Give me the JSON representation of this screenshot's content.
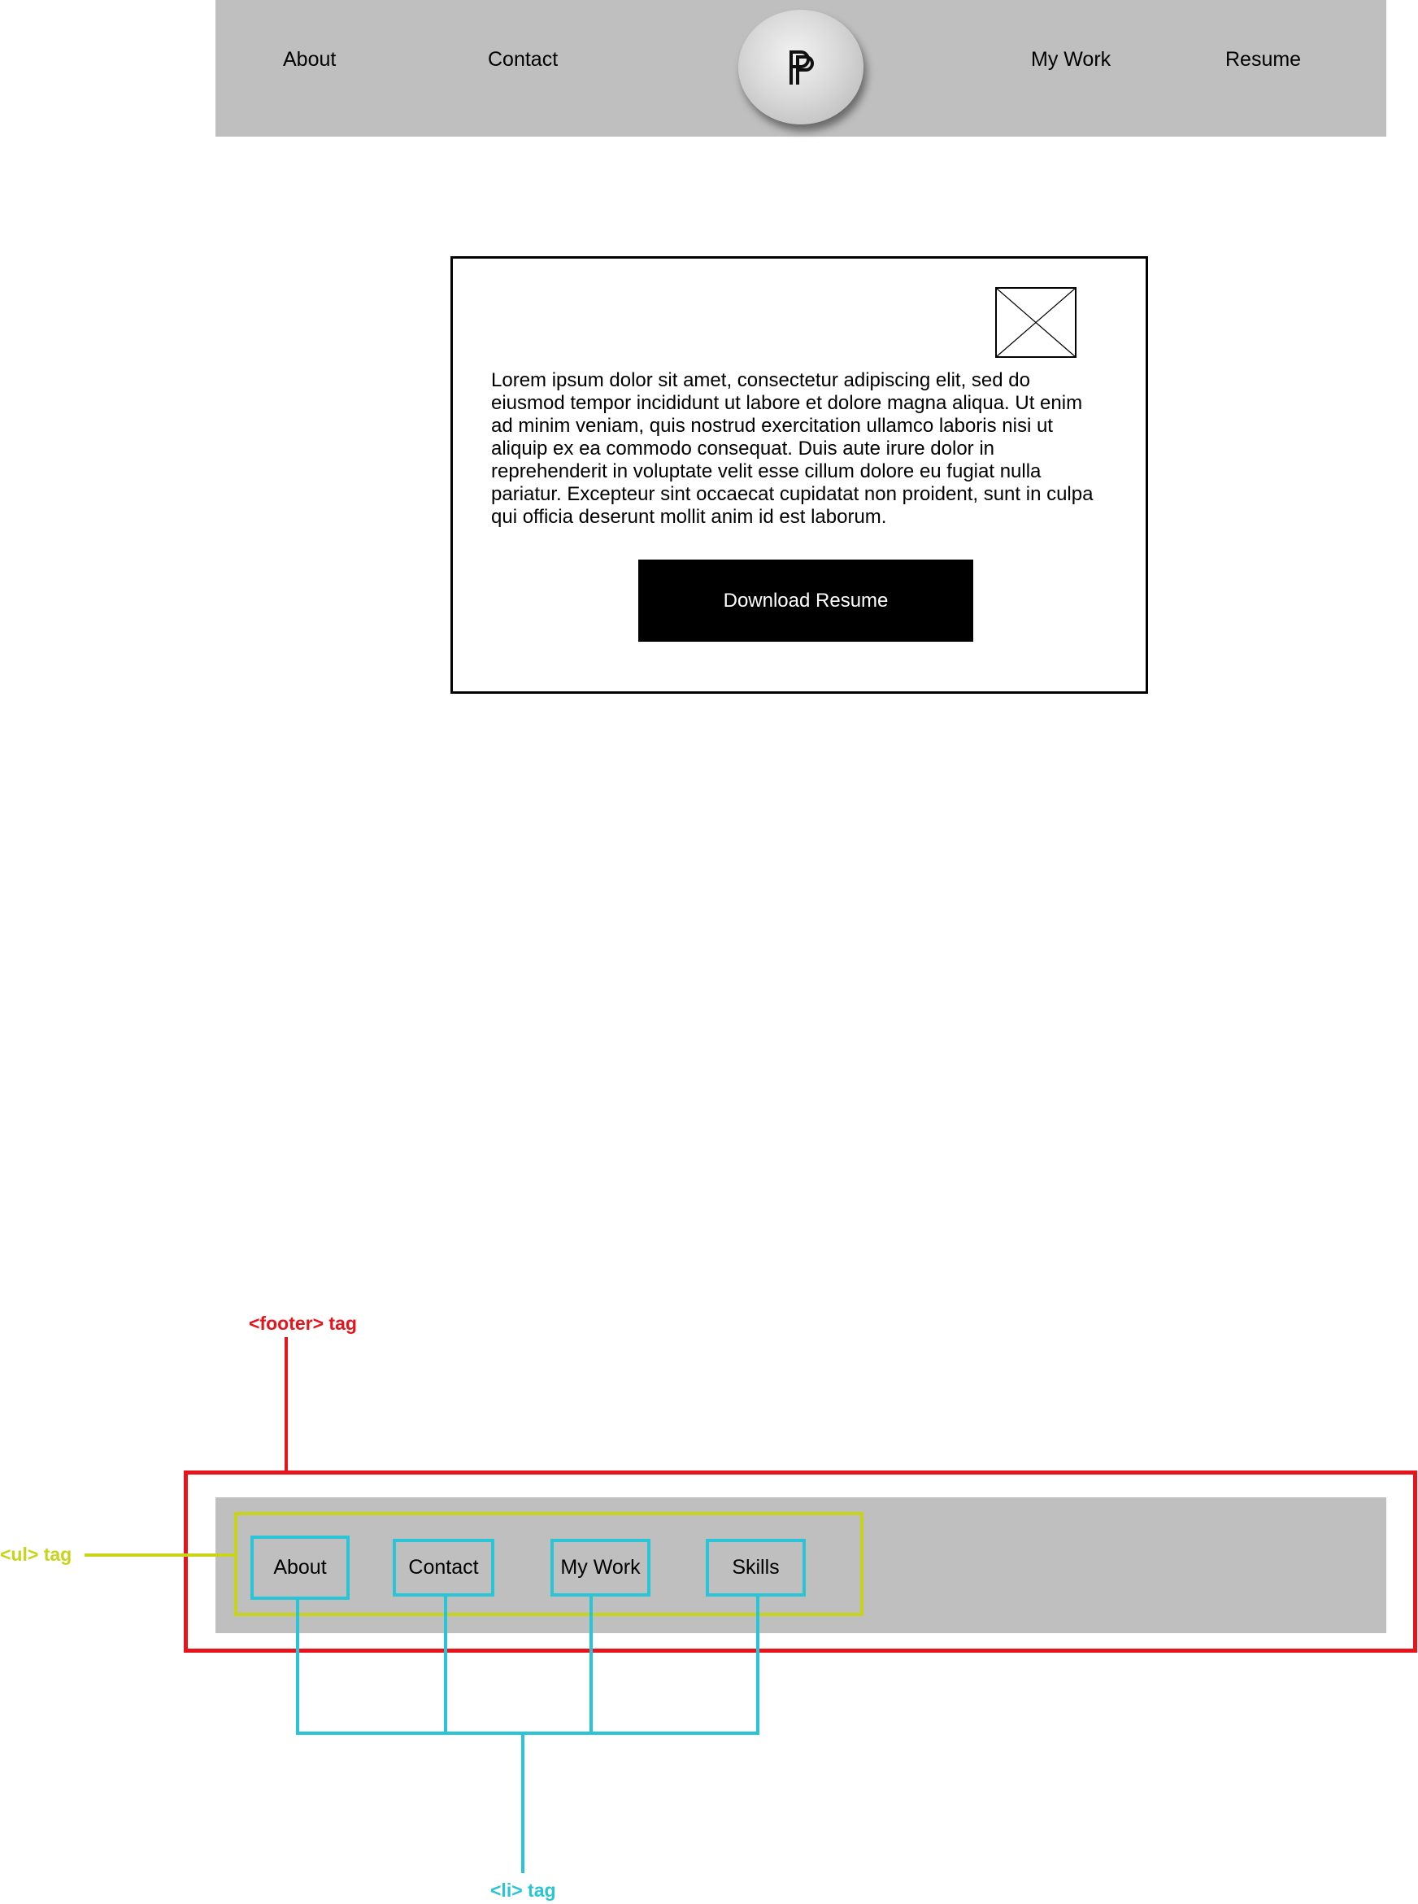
{
  "header": {
    "nav": [
      "About",
      "Contact",
      "My Work",
      "Resume"
    ],
    "logo_icon": "pp-monogram-logo-icon"
  },
  "content": {
    "image_placeholder_icon": "image-placeholder-icon",
    "paragraph": "Lorem ipsum dolor sit amet, consectetur adipiscing elit, sed do eiusmod tempor incididunt ut labore et dolore magna aliqua. Ut enim ad minim veniam, quis nostrud exercitation ullamco laboris nisi ut aliquip ex ea commodo consequat. Duis aute irure dolor in reprehenderit in voluptate velit esse cillum dolore eu fugiat nulla pariatur. Excepteur sint occaecat cupidatat non proident, sunt in culpa qui officia deserunt mollit anim id est laborum.",
    "button": "Download Resume"
  },
  "footer": {
    "items": [
      "About",
      "Contact",
      "My Work",
      "Skills"
    ]
  },
  "annotations": {
    "footer_tag": "<footer> tag",
    "ul_tag": "<ul> tag",
    "li_tag": "<li> tag"
  },
  "colors": {
    "gray_bar": "#bfbfbf",
    "footer_annotation": "#e8141c",
    "ul_annotation": "#c8d419",
    "li_annotation": "#29c4d6"
  }
}
